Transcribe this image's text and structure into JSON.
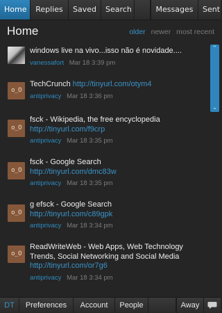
{
  "tabs": {
    "home": "Home",
    "replies": "Replies",
    "saved": "Saved",
    "search": "Search",
    "messages": "Messages",
    "sent": "Sent"
  },
  "header": {
    "title": "Home",
    "older": "older",
    "newer": "newer",
    "most_recent": "most recent"
  },
  "tweets": [
    {
      "text": "windows live na vivo...isso não é novidade....",
      "link": "",
      "user": "vanessafort",
      "time": "Mar 18  3:39 pm",
      "avatar": "photo"
    },
    {
      "text": "TechCrunch ",
      "link": "http://tinyurl.com/otym4",
      "user": "antiprivacy",
      "time": "Mar 18  3:36 pm",
      "avatar": "o_O"
    },
    {
      "text": "fsck - Wikipedia, the free encyclopedia",
      "link": "http://tinyurl.com/f9crp",
      "user": "antiprivacy",
      "time": "Mar 18  3:35 pm",
      "avatar": "o_O"
    },
    {
      "text": "fsck - Google Search",
      "link": "http://tinyurl.com/dmc83w",
      "user": "antiprivacy",
      "time": "Mar 18  3:35 pm",
      "avatar": "o_O"
    },
    {
      "text": "g efsck - Google Search",
      "link": "http://tinyurl.com/c89gpk",
      "user": "antiprivacy",
      "time": "Mar 18  3:34 pm",
      "avatar": "o_O"
    },
    {
      "text": "ReadWriteWeb - Web Apps, Web Technology Trends, Social Networking and Social Media",
      "link": "http://tinyurl.com/or7g6",
      "user": "antiprivacy",
      "time": "Mar 18  3:34 pm",
      "avatar": "o_O"
    }
  ],
  "bottombar": {
    "dt": "DT",
    "preferences": "Preferences",
    "account": "Account",
    "people": "People",
    "away": "Away"
  },
  "colors": {
    "accent": "#2f86bd",
    "link": "#3a93c7",
    "background": "#252525"
  },
  "icons": {
    "scroll_up": "chevron-up-icon",
    "scroll_down": "chevron-down-icon",
    "chat": "speech-bubble-icon"
  }
}
